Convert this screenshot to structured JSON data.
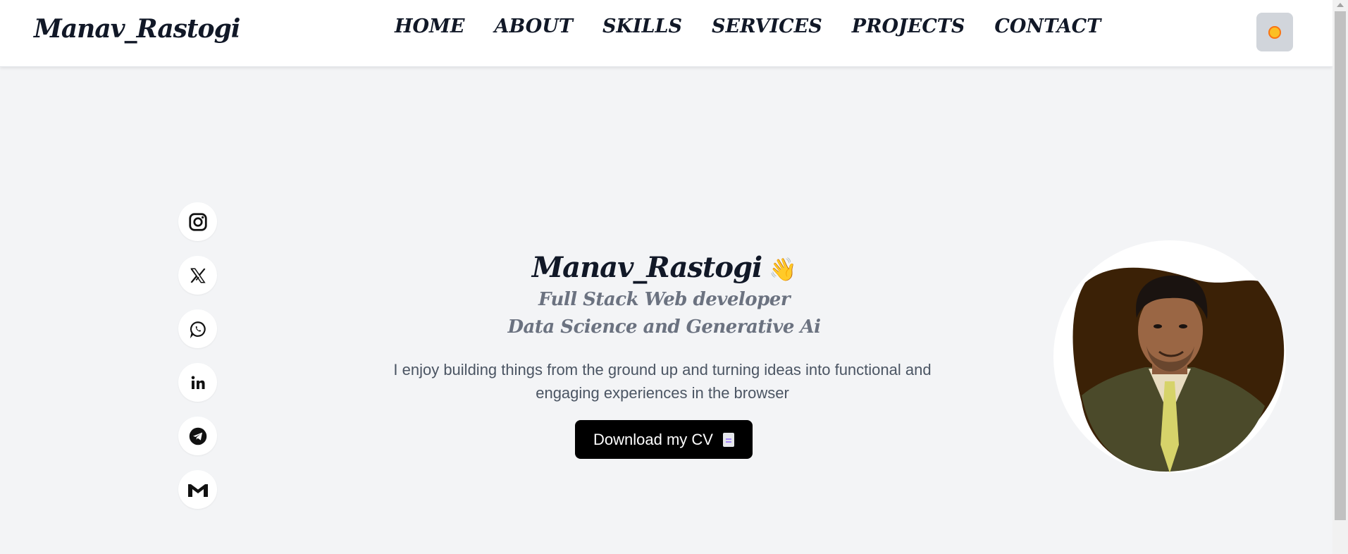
{
  "brand": {
    "logo_text": "Manav_Rastogi"
  },
  "nav": {
    "items": [
      {
        "label": "HOME"
      },
      {
        "label": "ABOUT"
      },
      {
        "label": "SKILLS"
      },
      {
        "label": "SERVICES"
      },
      {
        "label": "PROJECTS"
      },
      {
        "label": "CONTACT"
      }
    ],
    "theme_toggle_icon": "sun-icon"
  },
  "socials": [
    {
      "icon": "instagram-icon"
    },
    {
      "icon": "x-twitter-icon"
    },
    {
      "icon": "whatsapp-icon"
    },
    {
      "icon": "linkedin-icon"
    },
    {
      "icon": "telegram-icon"
    },
    {
      "icon": "gmail-icon"
    }
  ],
  "hero": {
    "name": "Manav_Rastogi",
    "wave_emoji": "👋",
    "role_line1": "Full Stack Web developer",
    "role_line2": "Data Science and Generative Ai",
    "description": "I enjoy building things from the ground up and turning ideas into functional and engaging experiences in the browser",
    "cv_button": "Download my CV"
  },
  "colors": {
    "background": "#f3f4f6",
    "navbar": "#ffffff",
    "text_dark": "#111827",
    "text_muted": "#6b7280",
    "button_bg": "#000000",
    "avatar_blob": "#3b2106"
  }
}
